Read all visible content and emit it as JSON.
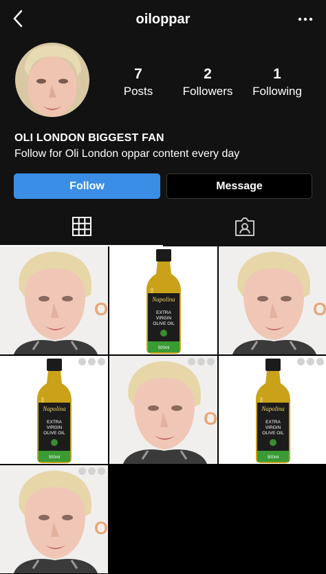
{
  "header": {
    "username": "oiloppar",
    "back_icon": "chevron-left-icon",
    "more_icon": "more-horizontal-icon"
  },
  "profile": {
    "stats": [
      {
        "value": "7",
        "label": "Posts"
      },
      {
        "value": "2",
        "label": "Followers"
      },
      {
        "value": "1",
        "label": "Following"
      }
    ],
    "name": "OLI LONDON BIGGEST FAN",
    "bio": "Follow for Oli London oppar content every day",
    "follow_label": "Follow",
    "message_label": "Message"
  },
  "tabs": [
    {
      "icon": "grid-icon",
      "active": true
    },
    {
      "icon": "tagged-icon",
      "active": false
    }
  ],
  "posts": [
    {
      "type": "portrait"
    },
    {
      "type": "olive-oil"
    },
    {
      "type": "portrait"
    },
    {
      "type": "olive-oil"
    },
    {
      "type": "portrait"
    },
    {
      "type": "olive-oil"
    },
    {
      "type": "portrait"
    }
  ],
  "product": {
    "brand": "Napolina",
    "line1": "EXTRA",
    "line2": "VIRGIN",
    "line3": "OLIVE OIL",
    "volume": "500ml"
  },
  "colors": {
    "background": "#000000",
    "surface": "#121212",
    "follow_button": "#3a8ee6",
    "oil": "#c9a21a",
    "label_green": "#2f7a2a"
  }
}
